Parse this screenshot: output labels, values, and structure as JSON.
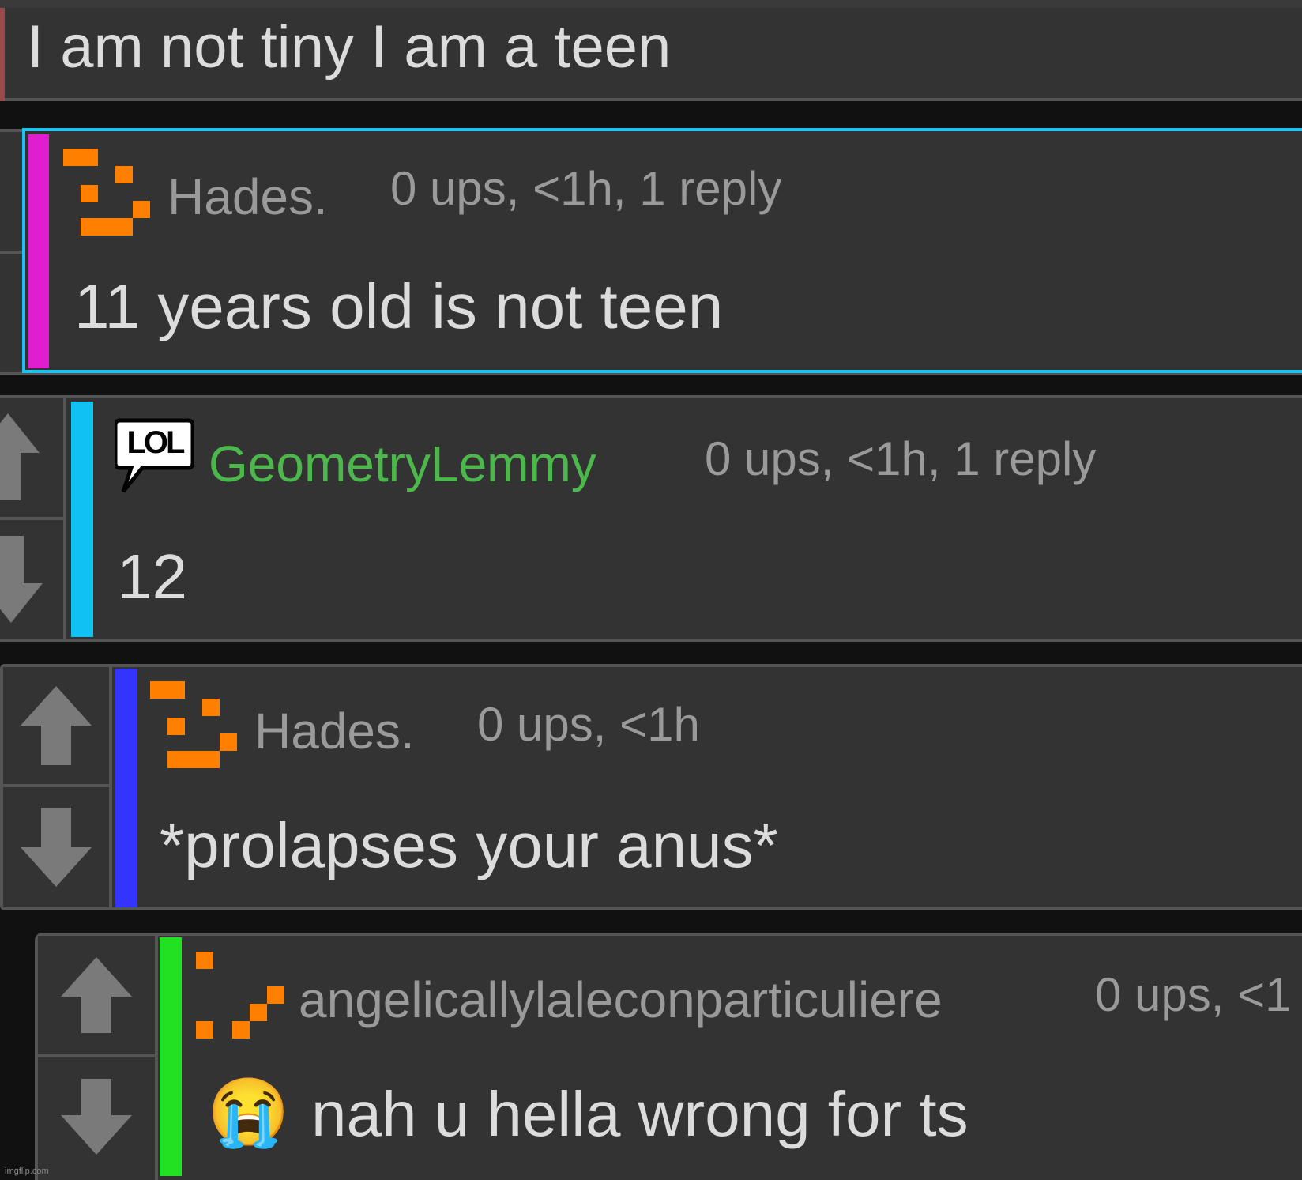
{
  "colors": {
    "background": "#111111",
    "panel": "#333333",
    "panel_border": "#555555",
    "text": "#dcdcdc",
    "meta": "#9a9a9a",
    "username_green": "#4cb84c",
    "highlight_border": "#1cc2f0",
    "pixel_icon": "#ff7f00",
    "bar_top": "#9b4a4a",
    "bar_hades_1": "#e01ed0",
    "bar_geometry": "#10c2f4",
    "bar_hades_2": "#3434ff",
    "bar_angelic": "#22e022",
    "arrow": "#7a7a7a"
  },
  "comments": [
    {
      "body": "I am not tiny I am a teen"
    },
    {
      "username": "Hades.",
      "meta": "0 ups, <1h, 1 reply",
      "body": "11 years old is not teen",
      "icon": "pixel-smile-icon"
    },
    {
      "username": "GeometryLemmy",
      "meta": "0 ups, <1h, 1 reply",
      "body": "12",
      "badge": "LOL",
      "icon": "lol-speech-bubble-icon"
    },
    {
      "username": "Hades.",
      "meta": "0 ups, <1h",
      "body": "*prolapses your anus*",
      "icon": "pixel-smile-icon"
    },
    {
      "username": "angelicallylaleconparticuliere",
      "meta": "0 ups, <1",
      "body": "nah u hella wrong for ts",
      "emoji": "😭",
      "icon": "pixel-check-icon"
    }
  ],
  "watermark": "imgflip.com"
}
